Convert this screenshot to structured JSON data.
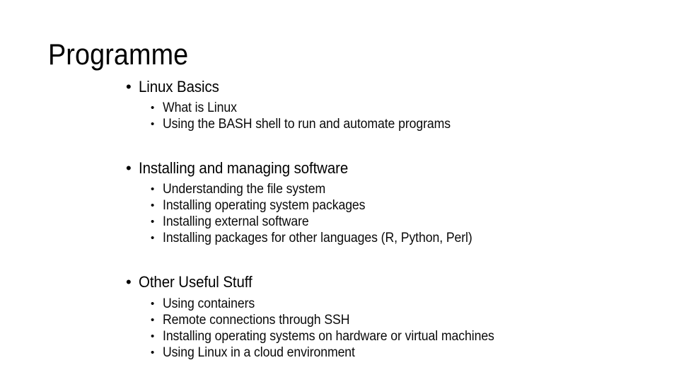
{
  "slide": {
    "title": "Programme",
    "background_color": "#ffffff",
    "text_color": "#000000",
    "bullet_glyph": "•",
    "sections": [
      {
        "heading": "Linux Basics",
        "items": [
          "What is Linux",
          "Using the BASH shell to run and automate programs"
        ]
      },
      {
        "heading": "Installing and managing software",
        "items": [
          "Understanding the file system",
          "Installing operating system packages",
          "Installing external software",
          "Installing packages for other languages (R, Python, Perl)"
        ]
      },
      {
        "heading": "Other Useful Stuff",
        "items": [
          "Using containers",
          "Remote connections through SSH",
          "Installing operating systems on hardware or virtual machines",
          "Using Linux in a cloud environment"
        ]
      }
    ]
  }
}
